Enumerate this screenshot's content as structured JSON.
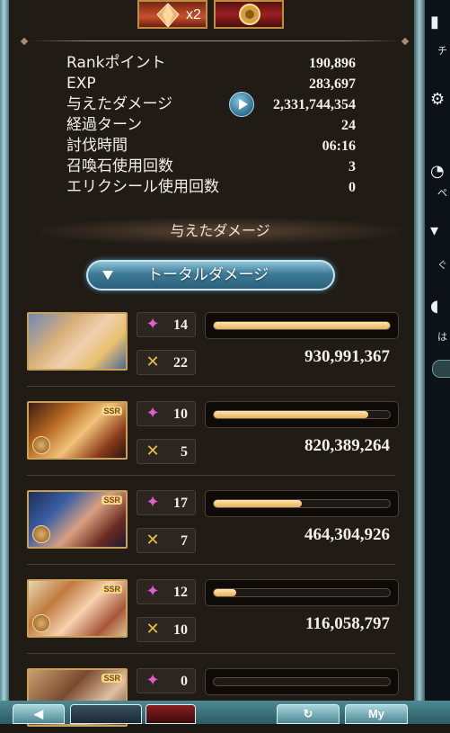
{
  "top_items": {
    "quantity": "x2"
  },
  "stats": [
    {
      "label": "Rankポイント",
      "value": "190,896"
    },
    {
      "label": "EXP",
      "value": "283,697"
    },
    {
      "label": "与えたダメージ",
      "value": "2,331,744,354"
    },
    {
      "label": "経過ターン",
      "value": "24"
    },
    {
      "label": "討伐時間",
      "value": "06:16"
    },
    {
      "label": "召喚石使用回数",
      "value": "3"
    },
    {
      "label": "エリクシール使用回数",
      "value": "0"
    }
  ],
  "section_title": "与えたダメージ",
  "damage_tab": {
    "label": "トータルダメージ"
  },
  "characters": [
    {
      "portrait": "main-character-duo",
      "ssr": false,
      "skill_count": "14",
      "ougi_count": "22",
      "damage_fraction": 1.0,
      "damage": "930,991,367"
    },
    {
      "portrait": "horned-warrior",
      "ssr": true,
      "skill_count": "10",
      "ougi_count": "5",
      "damage_fraction": 0.88,
      "damage": "820,389,264"
    },
    {
      "portrait": "helmeted-warrior",
      "ssr": true,
      "skill_count": "17",
      "ougi_count": "7",
      "damage_fraction": 0.5,
      "damage": "464,304,926"
    },
    {
      "portrait": "flower-girl",
      "ssr": true,
      "skill_count": "12",
      "ougi_count": "10",
      "damage_fraction": 0.125,
      "damage": "116,058,797"
    },
    {
      "portrait": "partial-character",
      "ssr": true,
      "skill_count": "0",
      "ougi_count": "",
      "damage_fraction": 0,
      "damage": ""
    }
  ],
  "side_panel": {
    "labels": [
      "チ",
      "ペ",
      "ぐ",
      "は"
    ]
  },
  "bottom_bar": {
    "my_label": "My"
  },
  "icons": {
    "skill": "sparkle-star-icon",
    "ougi": "crossed-swords-icon",
    "play": "play-icon",
    "tab_arrow": "triangle-down-icon"
  },
  "colors": {
    "accent": "#3e7b98",
    "bar_fill": "#e6b05a",
    "frame": "#9cc7cd"
  }
}
